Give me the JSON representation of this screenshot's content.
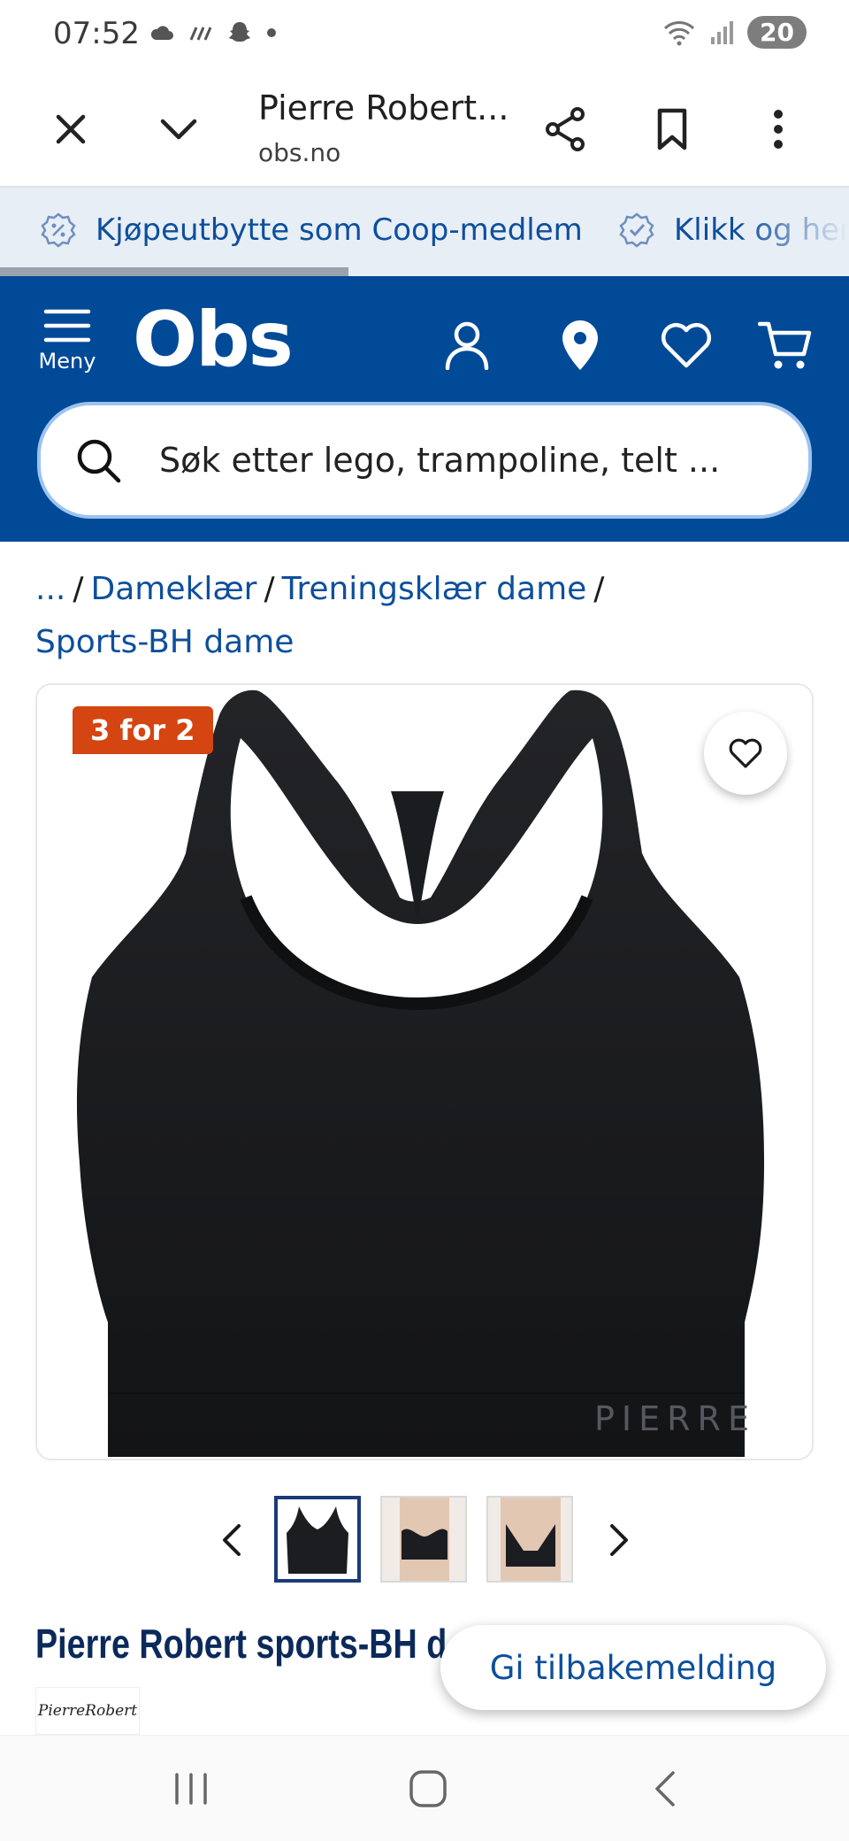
{
  "status_bar": {
    "time": "07:52",
    "battery": "20",
    "left_icons": [
      "cloud-icon",
      "signal-dots-icon",
      "snapchat-icon",
      "dot-icon"
    ],
    "right_icons": [
      "wifi-icon",
      "cell-signal-icon"
    ]
  },
  "browser": {
    "title": "Pierre Robert...",
    "url": "obs.no",
    "buttons": [
      "close-icon",
      "chevron-down-icon",
      "share-icon",
      "bookmark-icon",
      "more-vert-icon"
    ]
  },
  "promo_ticker": {
    "items": [
      {
        "text": "Kjøpeutbytte som Coop-medlem",
        "icon": "percent-badge-icon"
      },
      {
        "text": "Klikk og hent",
        "icon": "check-badge-icon"
      }
    ],
    "progress": 0.41
  },
  "header": {
    "menu_label": "Meny",
    "logo": "Obs",
    "icons": [
      "user-icon",
      "location-icon",
      "heart-icon",
      "cart-icon"
    ],
    "search_placeholder": "Søk etter lego, trampoline, telt ..."
  },
  "breadcrumb": {
    "ellipsis": "...",
    "items": [
      "Dameklær",
      "Treningsklær dame",
      "Sports-BH dame"
    ]
  },
  "product": {
    "badge": "3 for 2",
    "image_brand_text": "PIERRE",
    "title": "Pierre Robert sports-BH d",
    "brand_logo_text": "PierreRobert",
    "thumbnails": 3,
    "active_thumbnail": 1
  },
  "feedback": {
    "label": "Gi tilbakemelding"
  },
  "colors": {
    "brand_blue": "#004a98",
    "link_blue": "#0d4f9c",
    "badge_orange": "#d44511",
    "title_navy": "#0b2a5b"
  },
  "nav_bar": {
    "icons": [
      "recent-apps-icon",
      "home-icon",
      "back-icon"
    ]
  }
}
